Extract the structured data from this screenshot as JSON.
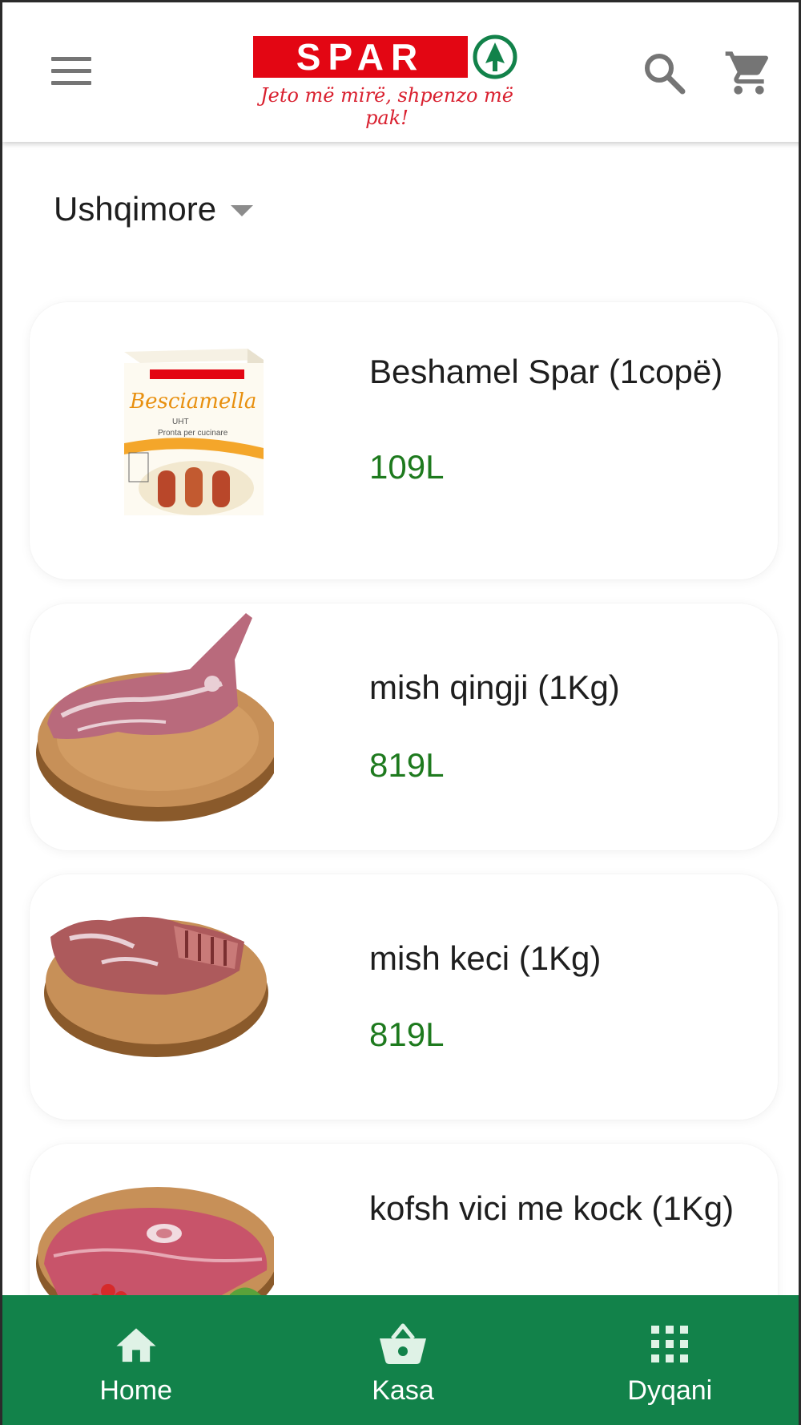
{
  "header": {
    "logo_text": "SPAR",
    "tagline": "Jeto më mirë, shpenzo më pak!",
    "icons": [
      "menu-icon",
      "search-icon",
      "cart-icon"
    ]
  },
  "category": {
    "label": "Ushqimore"
  },
  "products": [
    {
      "name": "Beshamel Spar (1copë)",
      "price": "109L",
      "image": "besciamella-carton"
    },
    {
      "name": "mish qingji (1Kg)",
      "price": "819L",
      "image": "lamb-meat-board"
    },
    {
      "name": "mish keci (1Kg)",
      "price": "819L",
      "image": "goat-meat-board"
    },
    {
      "name": "kofsh vici me kock (1Kg)",
      "price": "",
      "image": "veal-shank"
    }
  ],
  "bottom_nav": {
    "items": [
      {
        "label": "Home",
        "icon": "home-icon"
      },
      {
        "label": "Kasa",
        "icon": "basket-icon"
      },
      {
        "label": "Dyqani",
        "icon": "grid-icon"
      }
    ]
  },
  "colors": {
    "brand_red": "#e30613",
    "brand_green": "#12824a",
    "price_green": "#1e7a1e",
    "icon_grey": "#757575"
  }
}
